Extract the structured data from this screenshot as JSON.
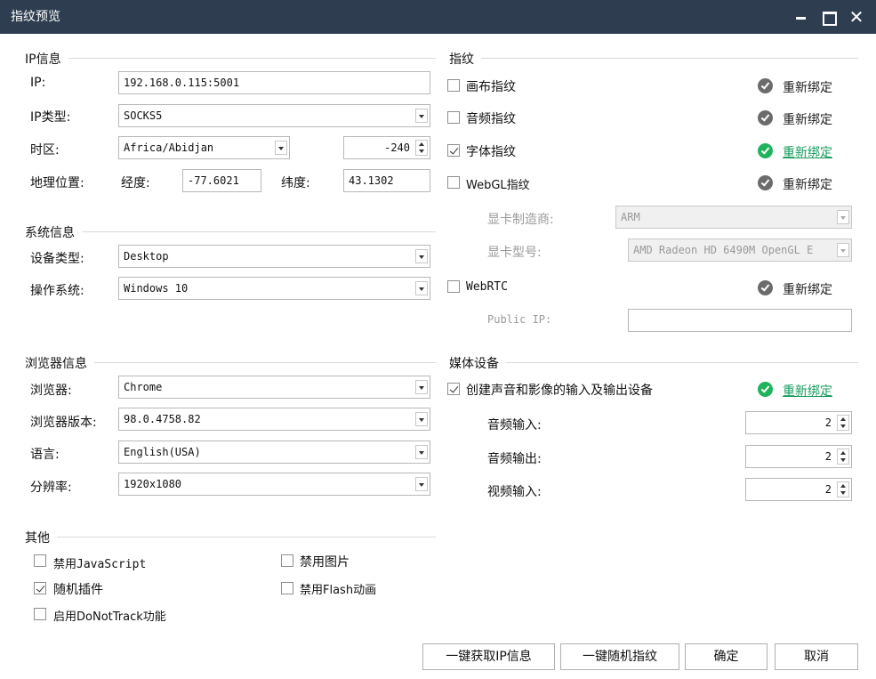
{
  "window": {
    "title": "指纹预览",
    "close_glyph": "✕"
  },
  "ip_info": {
    "section_title": "IP信息",
    "ip_label": "IP:",
    "ip_value": "192.168.0.115:5001",
    "ip_type_label": "IP类型:",
    "ip_type_value": "SOCKS5",
    "timezone_label": "时区:",
    "timezone_value": "Africa/Abidjan",
    "timezone_offset": "-240",
    "geo_label": "地理位置:",
    "longitude_label": "经度:",
    "longitude_value": "-77.6021",
    "latitude_label": "纬度:",
    "latitude_value": "43.1302"
  },
  "system_info": {
    "section_title": "系统信息",
    "device_type_label": "设备类型:",
    "device_type_value": "Desktop",
    "os_label": "操作系统:",
    "os_value": "Windows 10"
  },
  "browser_info": {
    "section_title": "浏览器信息",
    "browser_label": "浏览器:",
    "browser_value": "Chrome",
    "version_label": "浏览器版本:",
    "version_value": "98.0.4758.82",
    "language_label": "语言:",
    "language_value": "English(USA)",
    "resolution_label": "分辨率:",
    "resolution_value": "1920x1080"
  },
  "other": {
    "section_title": "其他",
    "items": [
      {
        "label": "禁用JavaScript",
        "checked": false
      },
      {
        "label": "禁用图片",
        "checked": false
      },
      {
        "label": "随机插件",
        "checked": true
      },
      {
        "label": "禁用Flash动画",
        "checked": false
      },
      {
        "label": "启用DoNotTrack功能",
        "checked": false
      }
    ]
  },
  "fingerprint": {
    "section_title": "指纹",
    "rebind_label": "重新绑定",
    "canvas": {
      "label": "画布指纹",
      "checked": false
    },
    "audio": {
      "label": "音频指纹",
      "checked": false
    },
    "font": {
      "label": "字体指纹",
      "checked": true
    },
    "webgl": {
      "label": "WebGL指纹",
      "checked": false
    },
    "gpu_vendor_label": "显卡制造商:",
    "gpu_vendor_value": "ARM",
    "gpu_model_label": "显卡型号:",
    "gpu_model_value": "AMD Radeon HD 6490M OpenGL E",
    "webrtc": {
      "label": "WebRTC",
      "checked": false
    },
    "public_ip_label": "Public IP:",
    "public_ip_value": ""
  },
  "media": {
    "section_title": "媒体设备",
    "create_devices_label": "创建声音和影像的输入及输出设备",
    "create_devices_checked": true,
    "audio_input_label": "音频输入:",
    "audio_input_value": "2",
    "audio_output_label": "音频输出:",
    "audio_output_value": "2",
    "video_input_label": "视频输入:",
    "video_input_value": "2"
  },
  "buttons": {
    "fetch_ip": "一键获取IP信息",
    "random_fp": "一键随机指纹",
    "ok": "确定",
    "cancel": "取消"
  },
  "colors": {
    "titlebar": "#2e3e50",
    "accent_green": "#1fb35c",
    "link_green": "#169c5c"
  }
}
